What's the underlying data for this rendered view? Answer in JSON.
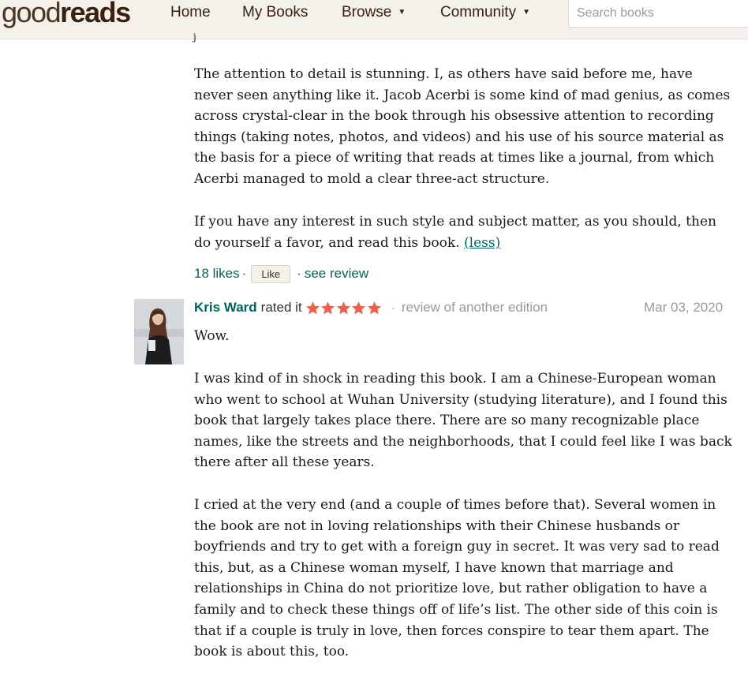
{
  "header": {
    "logo_light": "good",
    "logo_bold": "reads",
    "nav": [
      {
        "label": "Home"
      },
      {
        "label": "My Books"
      },
      {
        "label": "Browse",
        "caret": "▼"
      },
      {
        "label": "Community",
        "caret": "▼"
      }
    ],
    "search_placeholder": "Search books"
  },
  "previous_review": {
    "cut_mark": "j",
    "paragraphs": [
      "The attention to detail is stunning. I, as others have said before me, have never seen anything like it. Jacob Acerbi is some kind of mad genius, as comes across crystal-clear in the book through his obsessive attention to recording things (taking notes, photos, and videos) and his use of his source material as the basis for a piece of writing that reads at times like a journal, from which Acerbi managed to mold a clear three-act structure.",
      "If you have any interest in such style and subject matter, as you should, then do yourself a favor, and read this book. "
    ],
    "less_link": "(less)",
    "likes": "18 likes",
    "dot": "·",
    "like_button": "Like",
    "see_review": "see review"
  },
  "review": {
    "reviewer": "Kris Ward",
    "rated_text": "rated it",
    "rating": 5,
    "star_color": "#e8624c",
    "separator": "·",
    "edition_note": "review of another edition",
    "date": "Mar 03, 2020",
    "paragraphs": [
      "Wow.",
      "I was kind of in shock in reading this book. I am a Chinese-European woman who went to school at Wuhan University (studying literature), and I found this book that largely takes place there. There are so many recognizable place names, like the streets and the neighborhoods, that I could feel like I was back there after all these years.",
      "I cried at the very end (and a couple of times before that). Several women in the book are not in loving relationships with their Chinese husbands or boyfriends and try to get with a foreign guy in secret. It was very sad to read this, but, as a Chinese woman myself, I have known that marriage and relationships in China do not prioritize love, but rather obligation to have a family and to check these things off of life’s list. The other side of this coin is that if a couple is truly in love, then forces conspire to tear them apart. The book is about this, too."
    ]
  },
  "colors": {
    "header_bg": "#f4f1ea",
    "brand_brown": "#382110",
    "link_teal": "#00635d",
    "muted_gray": "#999999"
  }
}
